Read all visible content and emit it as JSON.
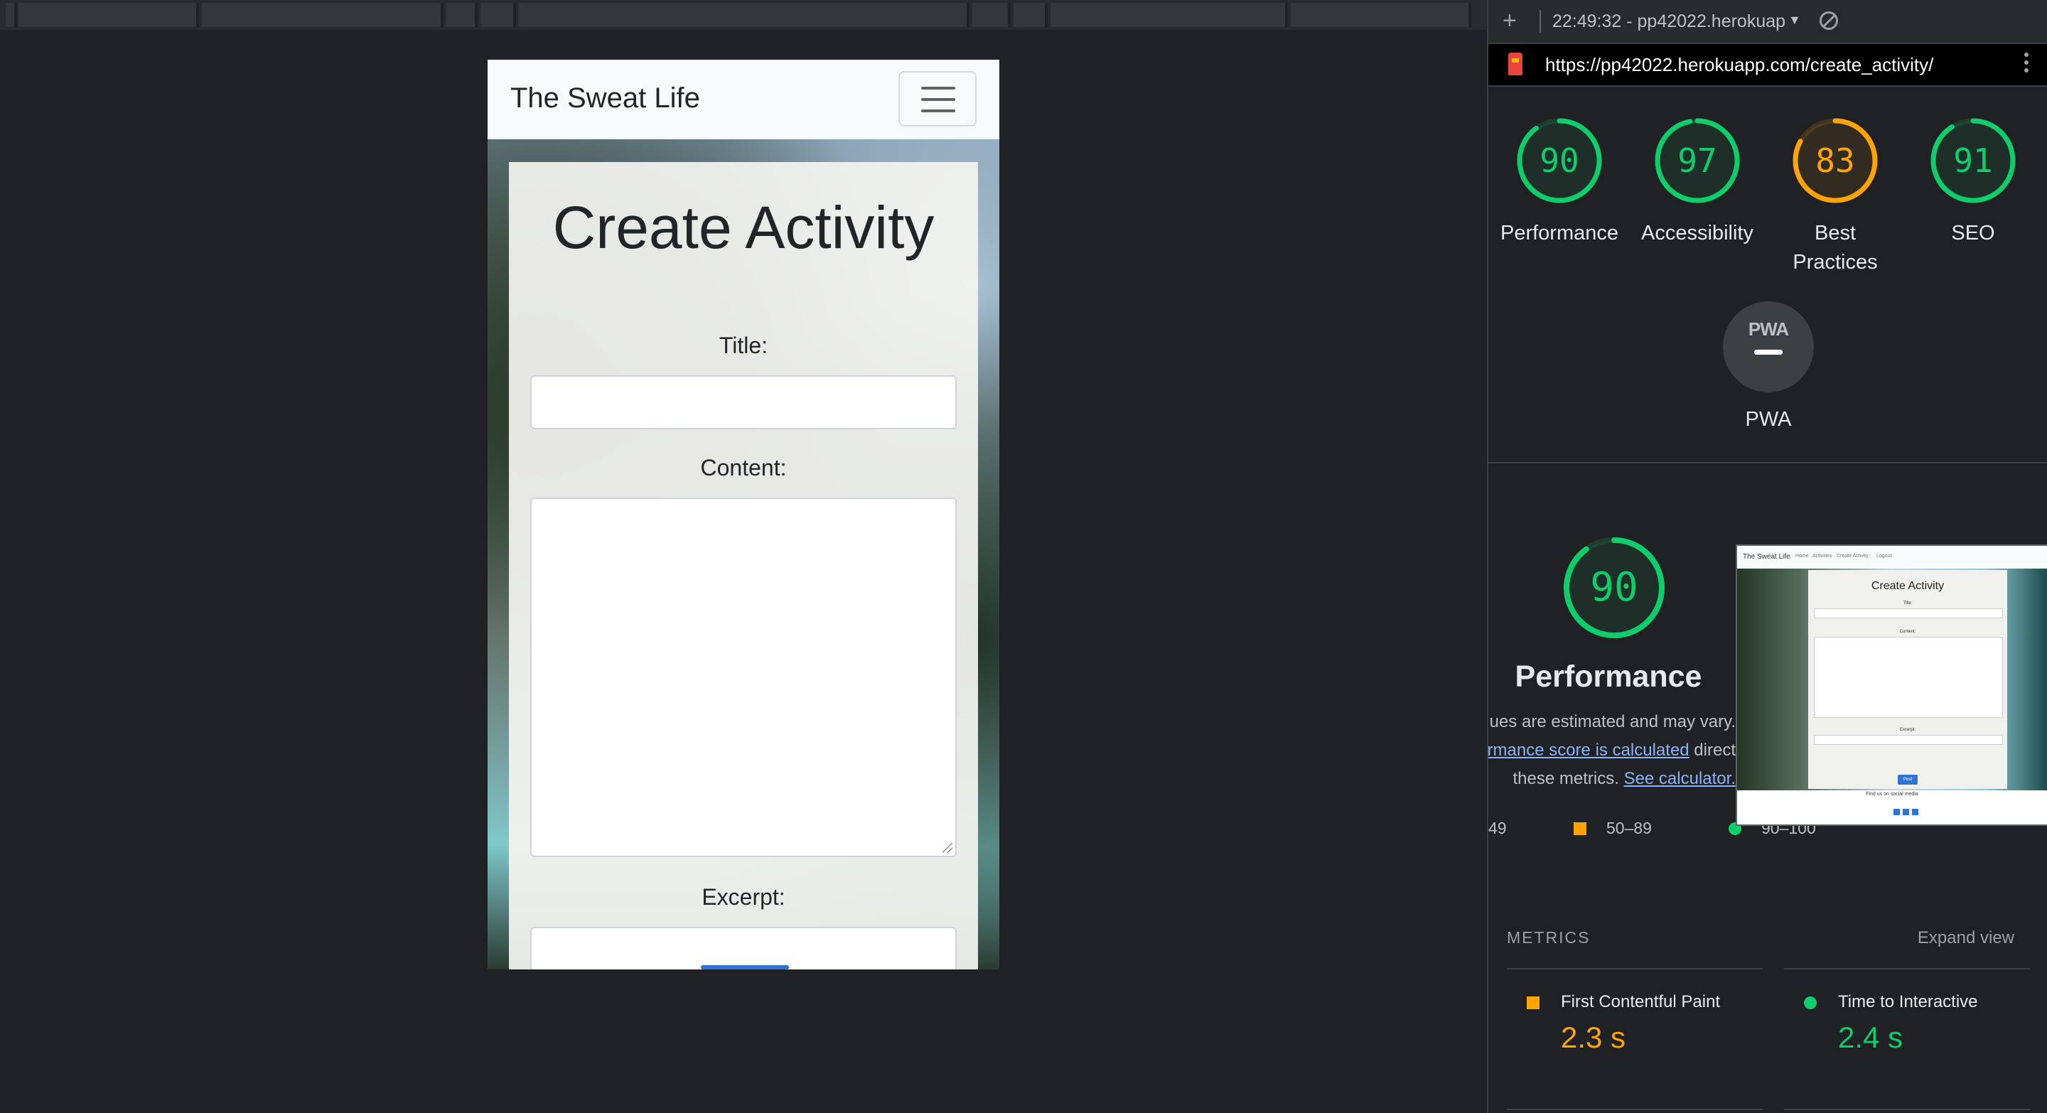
{
  "device": {
    "brand": "The Sweat Life",
    "form": {
      "heading": "Create Activity",
      "title_label": "Title:",
      "content_label": "Content:",
      "excerpt_label": "Excerpt:"
    }
  },
  "devtools": {
    "session": "22:49:32 - pp42022.herokuap",
    "url": "https://pp42022.herokuapp.com/create_activity/",
    "icons": {
      "new": "plus-icon",
      "clear": "block-icon",
      "lighthouse": "lighthouse-icon",
      "menu": "kebab-icon"
    }
  },
  "scores": [
    {
      "label": "Performance",
      "value": 90,
      "color": "#0cce6b"
    },
    {
      "label": "Accessibility",
      "value": 97,
      "color": "#0cce6b"
    },
    {
      "label": "Best Practices",
      "value": 83,
      "color": "#ffa400"
    },
    {
      "label": "SEO",
      "value": 91,
      "color": "#0cce6b"
    }
  ],
  "pwa": {
    "badge": "PWA",
    "label": "PWA"
  },
  "performance": {
    "score": 90,
    "title": "Performance",
    "note_line1": "lues are estimated and may vary.",
    "note_link1": "rmance score is calculated",
    "note_line2_rest": " direct",
    "note_line3": "these metrics.",
    "note_link2": "See calculator.",
    "legend": [
      "49",
      "50–89",
      "90–100"
    ]
  },
  "screenshot": {
    "brand": "The Sweat Life",
    "nav": [
      "Home",
      "Activities",
      "Create Activity",
      "Logout"
    ],
    "heading": "Create Activity",
    "labels": [
      "Title:",
      "Content:",
      "Excerpt:"
    ],
    "button": "Post",
    "footer": "Find us on social media"
  },
  "metrics": {
    "header": "METRICS",
    "expand": "Expand view",
    "items": [
      {
        "label": "First Contentful Paint",
        "value": "2.3 s",
        "color": "#ffa400"
      },
      {
        "label": "Time to Interactive",
        "value": "2.4 s",
        "color": "#0cce6b"
      }
    ]
  }
}
